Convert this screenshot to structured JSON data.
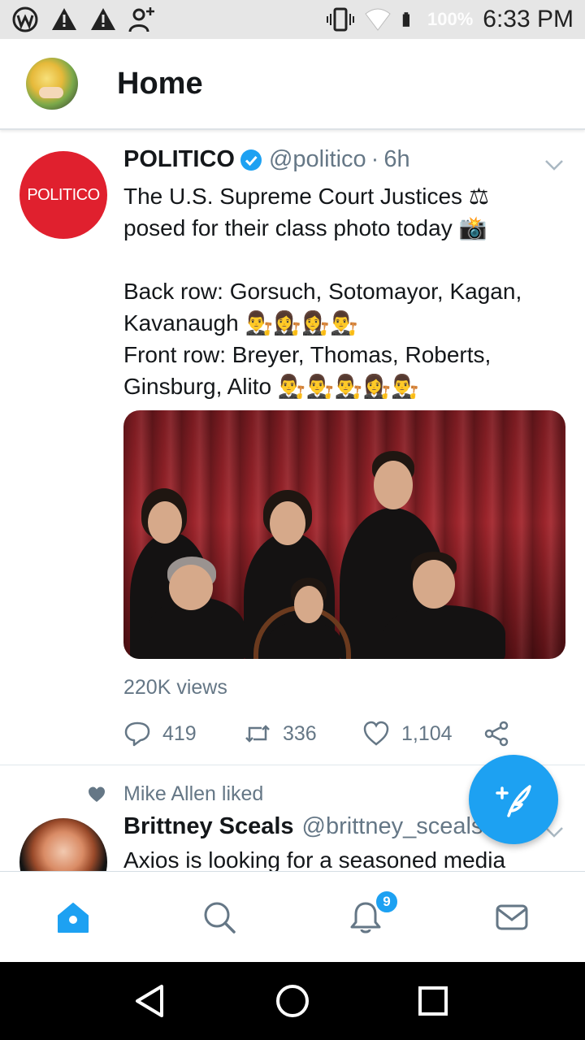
{
  "status_bar": {
    "battery": "100%",
    "time": "6:33 PM",
    "icons": [
      "wordpress-icon",
      "warning-icon",
      "warning-icon",
      "add-person-icon",
      "vibrate-icon",
      "wifi-icon",
      "battery-icon"
    ]
  },
  "header": {
    "title": "Home"
  },
  "tweets": [
    {
      "avatar_text": "POLITICO",
      "name": "POLITICO",
      "handle": "@politico",
      "separator": "·",
      "time": "6h",
      "text": "The U.S. Supreme Court Justices ⚖\nposed for their class photo today 📸\n\nBack row: Gorsuch, Sotomayor, Kagan,\nKavanaugh 👨‍⚖️👩‍⚖️👩‍⚖️👨‍⚖️\nFront row: Breyer, Thomas, Roberts,\nGinsburg, Alito 👨‍⚖️👨‍⚖️👨‍⚖️👩‍⚖️👨‍⚖️",
      "views": "220K views",
      "replies": "419",
      "retweets": "336",
      "likes": "1,104"
    },
    {
      "context": "Mike Allen liked",
      "name": "Brittney Sceals",
      "handle": "@brittney_sceals",
      "text": "Axios is looking for a seasoned media"
    }
  ],
  "bottom_nav": {
    "items": [
      "home-icon",
      "search-icon",
      "notifications-icon",
      "messages-icon"
    ],
    "notification_count": "9"
  },
  "colors": {
    "accent": "#1da1f2",
    "politico_red": "#e0202e",
    "secondary_text": "#657786"
  }
}
